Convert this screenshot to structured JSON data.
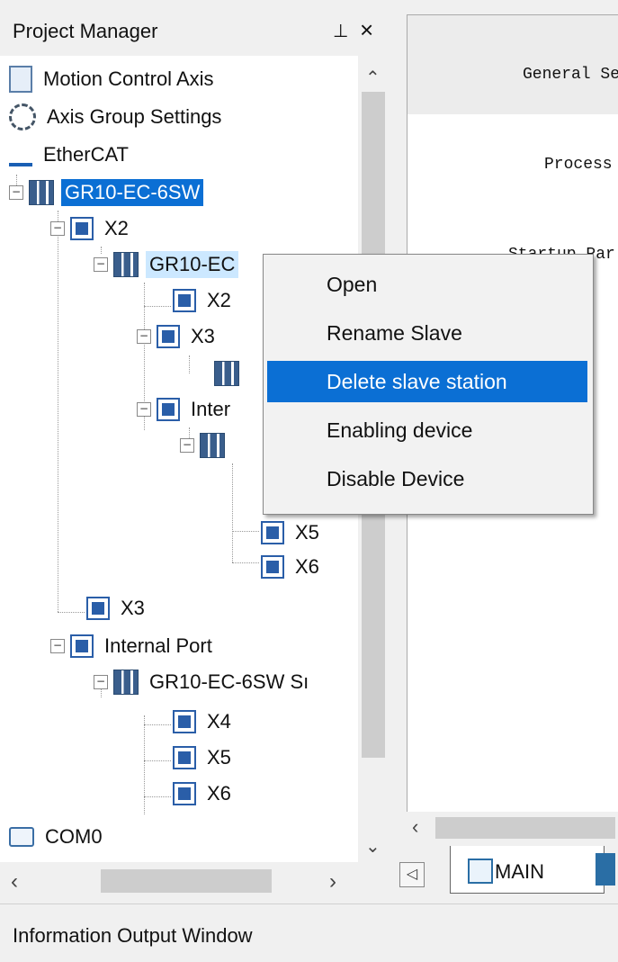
{
  "project_manager": {
    "title": "Project Manager",
    "pin_icon": "pin-icon",
    "close_icon": "close-icon",
    "tree": {
      "motion_control_axis": "Motion Control Axis",
      "axis_group_settings": "Axis Group Settings",
      "ethercat": "EtherCAT",
      "root_device": "GR10-EC-6SW",
      "x2": "X2",
      "child_device_partial": "GR10-EC",
      "child_x2": "X2",
      "child_x3": "X3",
      "child_internal_partial": "Inter",
      "child_x5": "X5",
      "child_x6": "X6",
      "x3": "X3",
      "internal_port": "Internal Port",
      "internal_device_partial": "GR10-EC-6SW Sı",
      "internal_x4": "X4",
      "internal_x5": "X5",
      "internal_x6": "X6",
      "com0": "COM0"
    }
  },
  "editor": {
    "header": "General Se",
    "process": "Process",
    "startup": "Startup Par",
    "tab_main": "MAIN"
  },
  "context_menu": {
    "items": [
      "Open",
      "Rename Slave",
      "Delete slave station",
      "Enabling device",
      "Disable Device"
    ],
    "selected": "Delete slave station"
  },
  "info_window": {
    "label": "Information Output Window"
  },
  "colors": {
    "selection": "#0b6fd4",
    "hover": "#cce8ff"
  }
}
